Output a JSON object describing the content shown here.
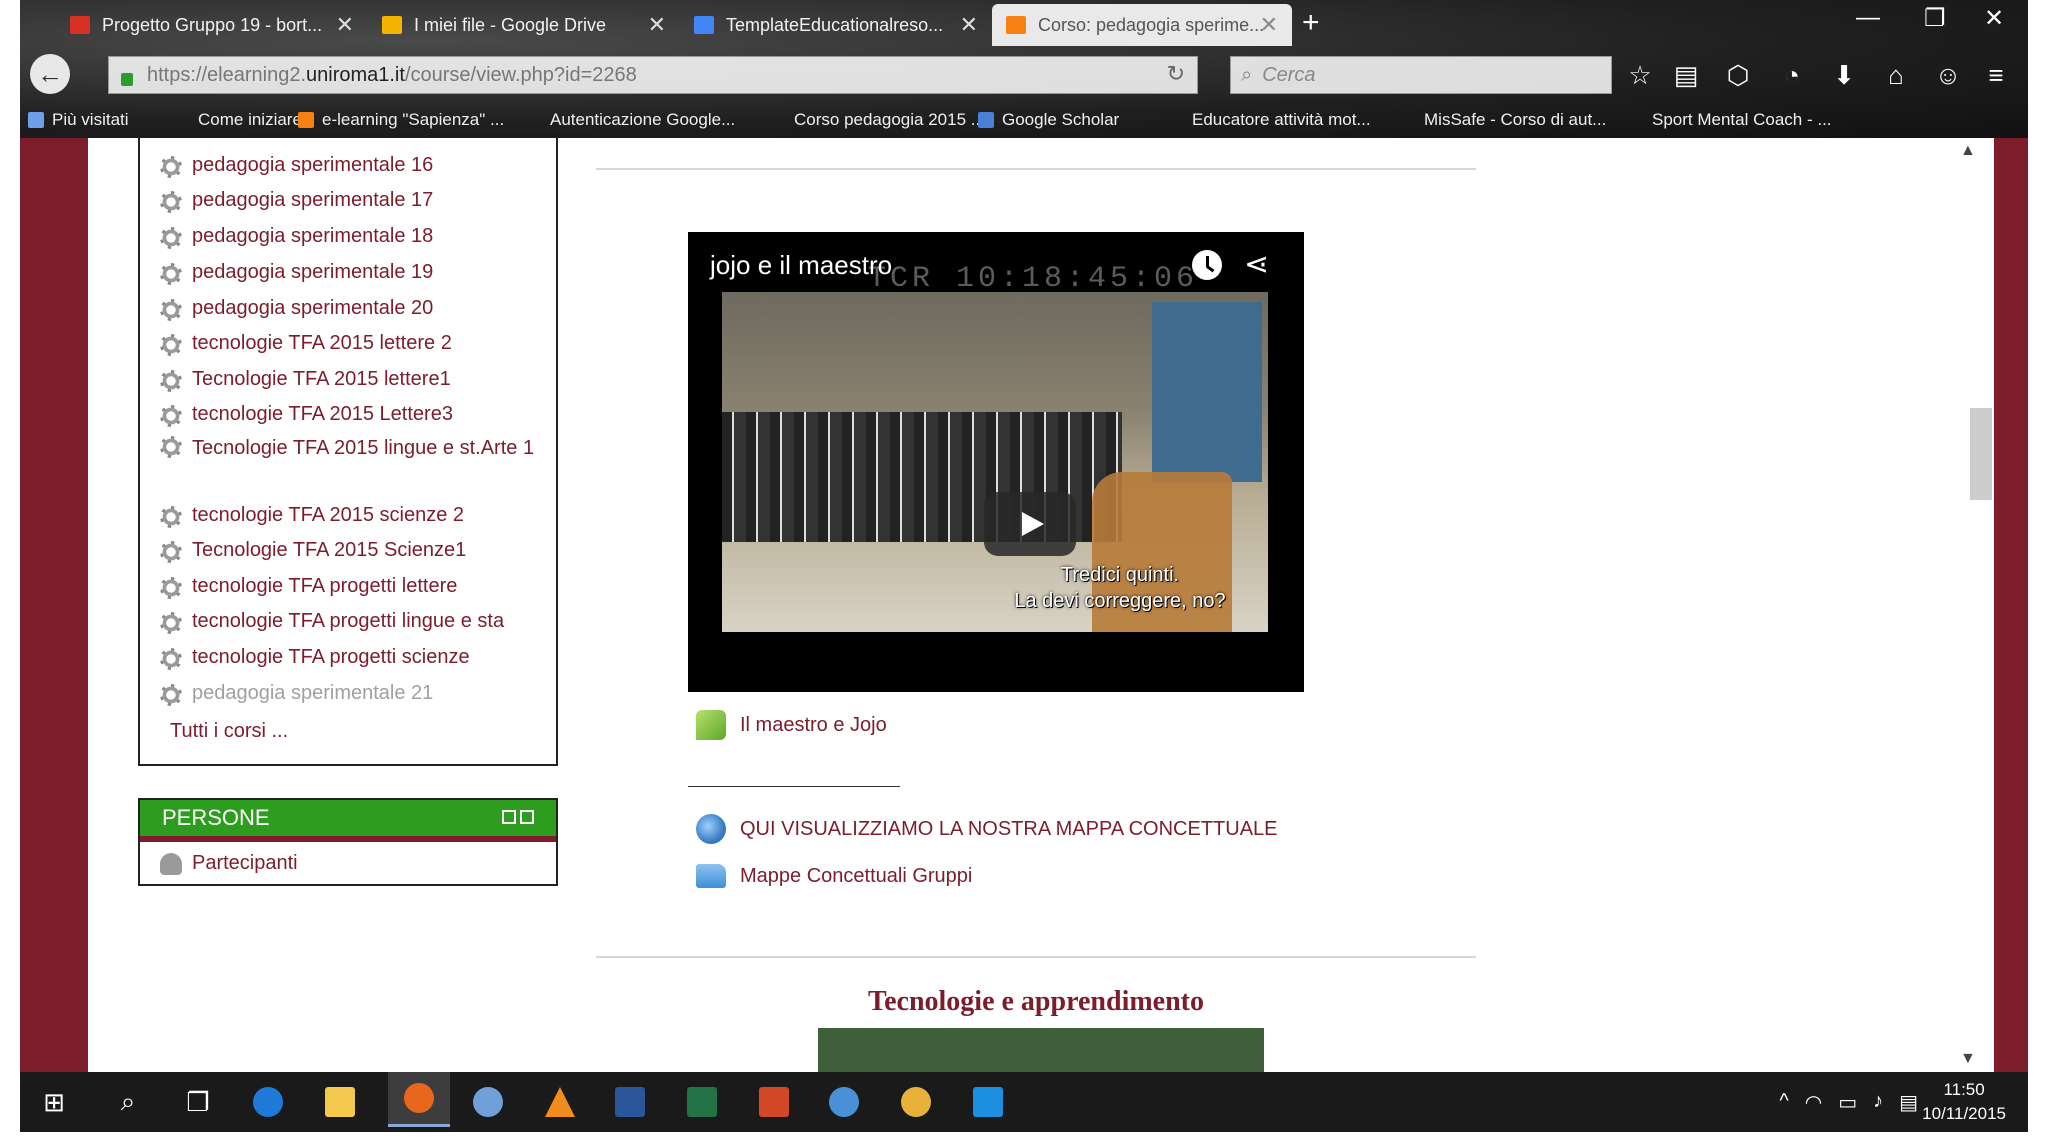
{
  "browser": {
    "tabs": [
      {
        "title": "Progetto Gruppo 19 - bort...",
        "icon": "gmail-icon",
        "color": "#d93025",
        "active": false
      },
      {
        "title": "I miei file - Google Drive",
        "icon": "google-drive-icon",
        "color": "#f4b400",
        "active": false
      },
      {
        "title": "TemplateEducationalreso...",
        "icon": "google-docs-icon",
        "color": "#4285f4",
        "active": false
      },
      {
        "title": "Corso: pedagogia sperime...",
        "icon": "moodle-icon",
        "color": "#f98012",
        "active": true
      }
    ],
    "url_prefix": "https://elearning2.",
    "url_host": "uniroma1.it",
    "url_path": "/course/view.php?id=2268",
    "search_placeholder": "Cerca",
    "bookmarks": [
      "Più visitati",
      "Come iniziare",
      "e-learning \"Sapienza\" ...",
      "Autenticazione Google...",
      "Corso pedagogia 2015 ...",
      "Google Scholar",
      "Educatore attività mot...",
      "MisSafe - Corso di aut...",
      "Sport Mental Coach - ..."
    ]
  },
  "courses": {
    "items": [
      "pedagogia sperimentale 16",
      "pedagogia sperimentale 17",
      "pedagogia sperimentale 18",
      "pedagogia sperimentale 19",
      "pedagogia sperimentale 20",
      "tecnologie TFA 2015 lettere 2",
      "Tecnologie TFA 2015 lettere1",
      "tecnologie TFA 2015 Lettere3",
      "Tecnologie TFA 2015 lingue e st.Arte 1",
      "tecnologie TFA 2015 scienze 2",
      "Tecnologie TFA 2015 Scienze1",
      "tecnologie TFA progetti lettere",
      "tecnologie TFA progetti lingue e sta",
      "tecnologie TFA progetti scienze",
      "pedagogia sperimentale 21"
    ],
    "all_courses": "Tutti i corsi ..."
  },
  "people_block": {
    "title": "PERSONE",
    "participants": "Partecipanti"
  },
  "video": {
    "title": "jojo e il maestro",
    "timecode": "TCR 10:18:45:06",
    "subtitle_line1": "Tredici quinti.",
    "subtitle_line2": "La devi correggere, no?"
  },
  "activities": {
    "forum": "Il maestro e Jojo",
    "map_link": "QUI VISUALIZZIAMO LA NOSTRA MAPPA CONCETTUALE",
    "folder": "Mappe Concettuali Gruppi"
  },
  "section": {
    "title": "Tecnologie e apprendimento"
  },
  "clock": {
    "time": "11:50",
    "date": "10/11/2015"
  }
}
